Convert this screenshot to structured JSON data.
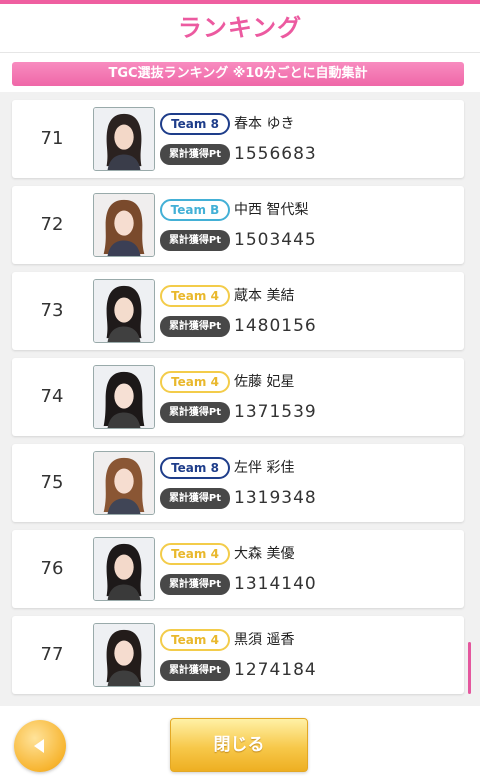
{
  "header": {
    "title": "ランキング",
    "banner": "TGC選抜ランキング ※10分ごとに自動集計"
  },
  "pt_label": "累計獲得Pt",
  "colors": {
    "accent_pink": "#ec5aa0",
    "team_8": "#1e3d8a",
    "team_b": "#43b0d6",
    "team_4": "#f3cc4a"
  },
  "ranking": [
    {
      "rank": "71",
      "team": "Team 8",
      "name": "春本 ゆき",
      "points": "1556683"
    },
    {
      "rank": "72",
      "team": "Team B",
      "name": "中西 智代梨",
      "points": "1503445"
    },
    {
      "rank": "73",
      "team": "Team 4",
      "name": "蔵本 美結",
      "points": "1480156"
    },
    {
      "rank": "74",
      "team": "Team 4",
      "name": "佐藤 妃星",
      "points": "1371539"
    },
    {
      "rank": "75",
      "team": "Team 8",
      "name": "左伴 彩佳",
      "points": "1319348"
    },
    {
      "rank": "76",
      "team": "Team 4",
      "name": "大森 美優",
      "points": "1314140"
    },
    {
      "rank": "77",
      "team": "Team 4",
      "name": "黒須 遥香",
      "points": "1274184"
    }
  ],
  "footer": {
    "back_icon": "triangle-left-icon",
    "close_label": "閉じる"
  }
}
